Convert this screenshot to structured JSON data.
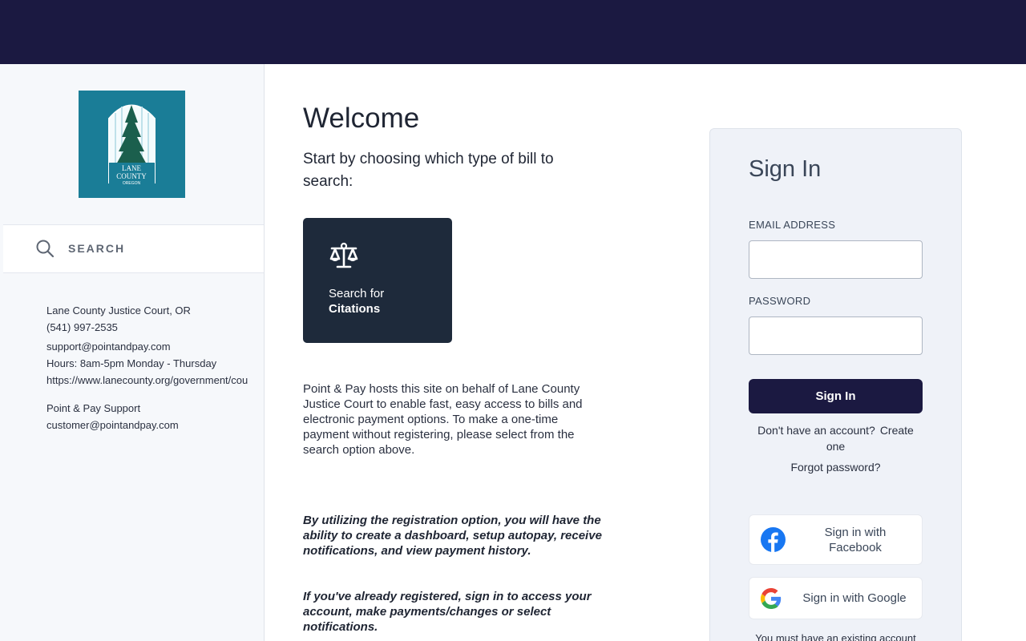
{
  "sidebar": {
    "logo_alt": "Lane County Oregon",
    "logo_text_line1": "LANE",
    "logo_text_line2": "COUNTY",
    "logo_text_line3": "OREGON",
    "search_label": "SEARCH",
    "contact_lines": [
      "Lane County Justice Court, OR",
      "(541) 997-2535",
      "support@pointandpay.com",
      "Hours: 8am-5pm Monday - Thursday",
      "https://www.lanecounty.org/government/cou"
    ],
    "support_title": "Point & Pay Support",
    "support_email": "customer@pointandpay.com"
  },
  "main": {
    "welcome": "Welcome",
    "intro": "Start by choosing which type of bill to search:",
    "tile": {
      "line1": "Search for",
      "line2": "Citations",
      "icon": "scales-icon"
    },
    "para1": "Point & Pay hosts this site on behalf of Lane County Justice Court to enable fast, easy access to bills and electronic payment options.  To make a one-time payment without registering, please select from the search option above.",
    "para2": "By utilizing the registration option, you will have the ability to create a dashboard, setup autopay, receive notifications, and view payment history.",
    "para3": "If you've already registered, sign in to access your account, make payments/changes or select notifications."
  },
  "signin": {
    "title": "Sign In",
    "email_label": "EMAIL ADDRESS",
    "email_value": "",
    "password_label": "PASSWORD",
    "password_value": "",
    "button": "Sign In",
    "no_account": "Don't have an account?",
    "create": "Create one",
    "forgot": "Forgot password?",
    "facebook": "Sign in with Facebook",
    "google": "Sign in with Google",
    "bottom_note": "You must have an existing account"
  },
  "colors": {
    "topbar": "#1b1941",
    "tile": "#1e2a3b",
    "facebook": "#1877f2"
  }
}
